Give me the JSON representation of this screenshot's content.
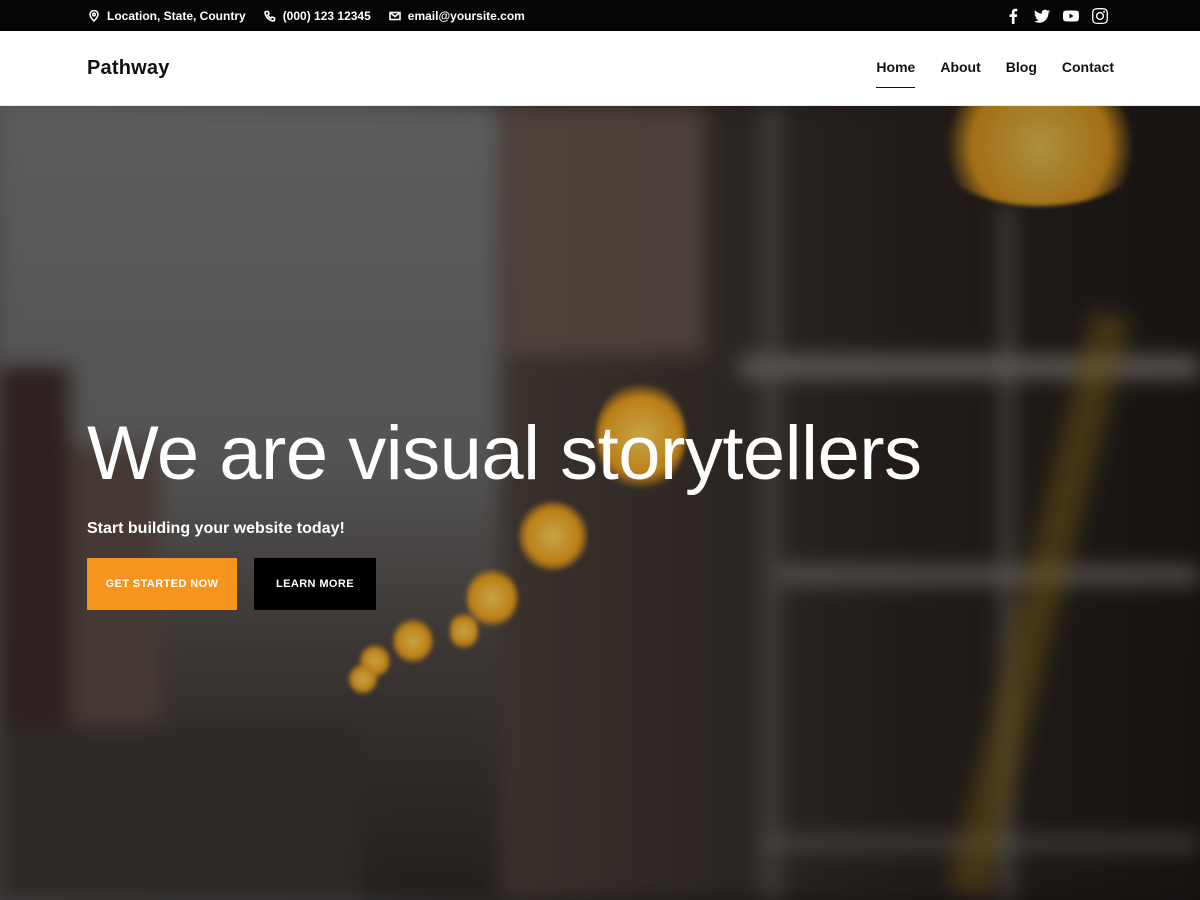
{
  "topbar": {
    "location": "Location, State, Country",
    "phone": "(000) 123 12345",
    "email": "email@yoursite.com",
    "social_icons": [
      "facebook-icon",
      "twitter-icon",
      "youtube-icon",
      "instagram-icon"
    ]
  },
  "header": {
    "logo": "Pathway",
    "nav": [
      {
        "label": "Home",
        "active": true
      },
      {
        "label": "About",
        "active": false
      },
      {
        "label": "Blog",
        "active": false
      },
      {
        "label": "Contact",
        "active": false
      }
    ]
  },
  "hero": {
    "headline": "We are visual storytellers",
    "subline": "Start building your website today!",
    "primary_button": "GET STARTED NOW",
    "secondary_button": "LEARN MORE"
  },
  "colors": {
    "accent": "#f7941d",
    "topbar_bg": "#050505",
    "header_bg": "#ffffff",
    "secondary_button_bg": "#000000"
  }
}
